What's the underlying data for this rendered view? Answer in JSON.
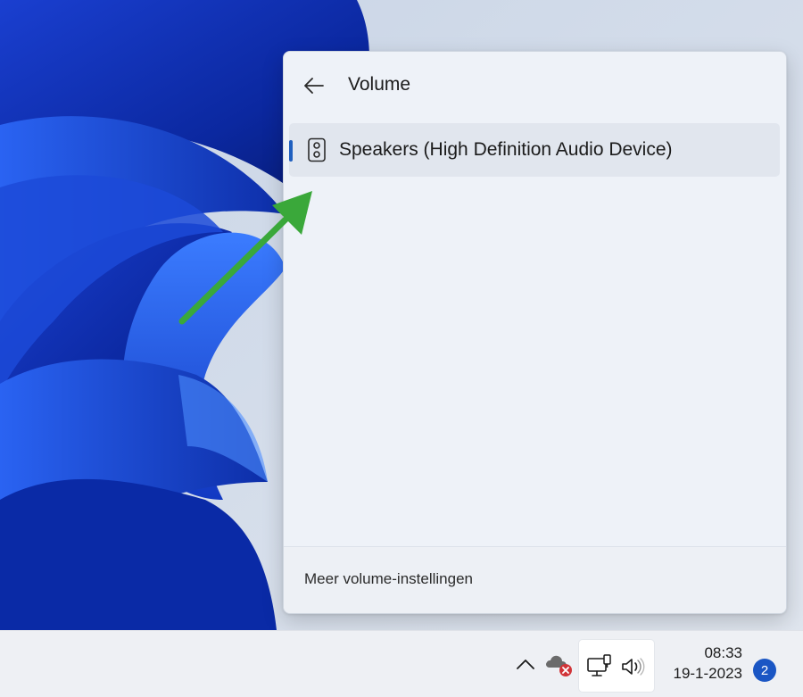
{
  "flyout": {
    "title": "Volume",
    "back_icon": "arrow-left-icon",
    "devices": [
      {
        "label": "Speakers (High Definition Audio Device)",
        "icon": "speaker-icon",
        "selected": true
      }
    ],
    "footer_link": "Meer volume-instellingen"
  },
  "taskbar": {
    "tray_icons": [
      "chevron-up-icon",
      "cloud-error-icon",
      "network-icon",
      "volume-icon"
    ],
    "time": "08:33",
    "date": "19-1-2023",
    "notification_count": "2"
  },
  "colors": {
    "accent": "#1f5fbf",
    "annotation_arrow": "#3aa83a",
    "wallpaper_dark": "#0b2a9e",
    "wallpaper_light": "#2f6cf0",
    "badge": "#1a56c4",
    "error": "#d13438"
  }
}
